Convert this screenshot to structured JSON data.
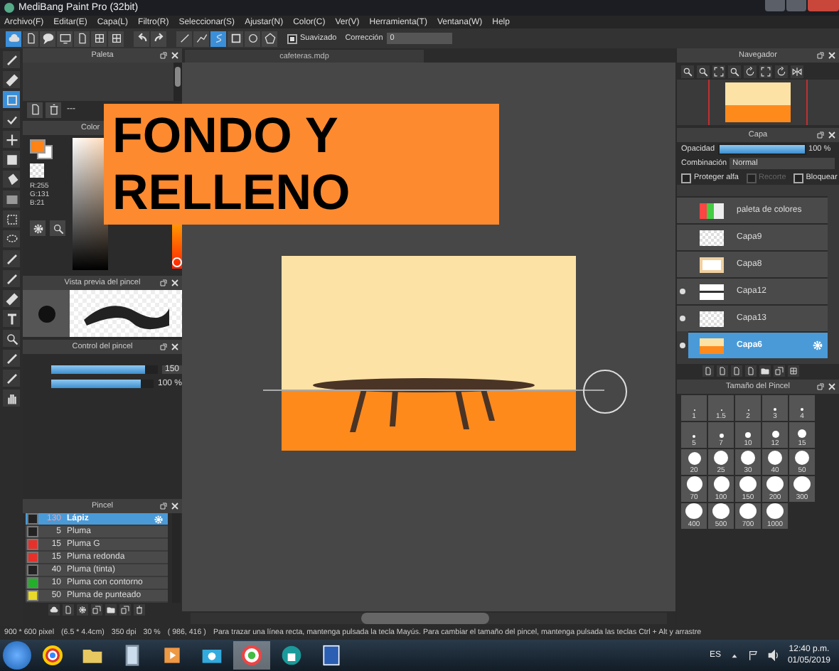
{
  "window": {
    "title": "MediBang Paint Pro (32bit)"
  },
  "menu": [
    "Archivo(F)",
    "Editar(E)",
    "Capa(L)",
    "Filtro(R)",
    "Seleccionar(S)",
    "Ajustar(N)",
    "Color(C)",
    "Ver(V)",
    "Herramienta(T)",
    "Ventana(W)",
    "Help"
  ],
  "toolbar": {
    "file_tools": [
      {
        "kind": "cloud",
        "selected": true
      },
      {
        "kind": "page",
        "selected": false
      },
      {
        "kind": "bubble",
        "selected": false
      },
      {
        "kind": "screen",
        "selected": false
      },
      {
        "kind": "page",
        "selected": false
      },
      {
        "kind": "grid",
        "selected": false
      },
      {
        "kind": "grid",
        "selected": false
      }
    ],
    "history": [
      {
        "kind": "undo"
      },
      {
        "kind": "redo"
      }
    ],
    "shape_tools": [
      {
        "kind": "line",
        "selected": false
      },
      {
        "kind": "polyline",
        "selected": false
      },
      {
        "kind": "curve",
        "selected": true
      },
      {
        "kind": "rect",
        "selected": false
      },
      {
        "kind": "circle",
        "selected": false
      },
      {
        "kind": "polygon",
        "selected": false
      }
    ],
    "smoothing": {
      "label": "Suavizado",
      "checked": true
    },
    "correction": {
      "label": "Corrección",
      "value": "0"
    }
  },
  "tools": [
    {
      "kind": "pen",
      "selected": false
    },
    {
      "kind": "eraser",
      "selected": false
    },
    {
      "kind": "rect",
      "selected": true
    },
    {
      "kind": "check",
      "selected": false
    },
    {
      "kind": "move",
      "selected": false
    },
    {
      "kind": "square",
      "selected": false
    },
    {
      "kind": "bucket",
      "selected": false
    },
    {
      "kind": "gradient",
      "selected": false
    },
    {
      "kind": "marquee",
      "selected": false
    },
    {
      "kind": "lasso",
      "selected": false
    },
    {
      "kind": "pen",
      "selected": false
    },
    {
      "kind": "pen",
      "selected": false
    },
    {
      "kind": "eraser",
      "selected": false
    },
    {
      "kind": "text",
      "selected": false
    },
    {
      "kind": "lens",
      "selected": false
    },
    {
      "kind": "pen",
      "selected": false
    },
    {
      "kind": "pen",
      "selected": false
    },
    {
      "kind": "hand",
      "selected": false
    }
  ],
  "palette": {
    "title": "Paleta",
    "selector": "---"
  },
  "color": {
    "title": "Color",
    "r": "R:255",
    "g": "G:131",
    "b": "B:21",
    "hue": {
      "level": 0.04
    }
  },
  "brush_preview": {
    "title": "Vista previa del pincel"
  },
  "brush_control": {
    "title": "Control del pincel",
    "sliders": [
      {
        "kind": "boxed",
        "level": 0.88,
        "reading": "150"
      },
      {
        "kind": "plain",
        "level": 0.88,
        "reading": "100 %"
      }
    ]
  },
  "brushes": {
    "title": "Pincel",
    "items": [
      {
        "size": "130",
        "name": "Lápiz",
        "color": "#222222",
        "selected": true
      },
      {
        "size": "5",
        "name": "Pluma",
        "color": "#222222",
        "selected": false
      },
      {
        "size": "15",
        "name": "Pluma G",
        "color": "#e8302a",
        "selected": false
      },
      {
        "size": "15",
        "name": "Pluma redonda",
        "color": "#e8302a",
        "selected": false
      },
      {
        "size": "40",
        "name": "Pluma (tinta)",
        "color": "#222222",
        "selected": false
      },
      {
        "size": "10",
        "name": "Pluma con contorno",
        "color": "#22b02a",
        "selected": false
      },
      {
        "size": "50",
        "name": "Pluma de punteado",
        "color": "#e8d82a",
        "selected": false
      }
    ]
  },
  "document": {
    "tab": "cafeteras.mdp"
  },
  "banner": "FONDO Y RELLENO",
  "navigator": {
    "title": "Navegador"
  },
  "layers": {
    "title": "Capa",
    "opacity_label": "Opacidad",
    "opacity": {
      "level": 1,
      "reading": "100 %"
    },
    "blend_label": "Combinación",
    "blend": "Normal",
    "options": [
      {
        "label": "Proteger alfa",
        "checked": false,
        "disabled": false
      },
      {
        "label": "Recorte",
        "checked": false,
        "disabled": true
      },
      {
        "label": "Bloquear",
        "checked": false,
        "disabled": false
      }
    ],
    "items": [
      {
        "name": "paleta de colores",
        "kind": "palette",
        "visible": false,
        "selected": false
      },
      {
        "name": "Capa9",
        "kind": "blank",
        "visible": false,
        "selected": false
      },
      {
        "name": "Capa8",
        "kind": "frame",
        "visible": false,
        "selected": false
      },
      {
        "name": "Capa12",
        "kind": "table",
        "visible": true,
        "selected": false
      },
      {
        "name": "Capa13",
        "kind": "blank",
        "visible": true,
        "selected": false
      },
      {
        "name": "Capa6",
        "kind": "orange",
        "visible": true,
        "selected": true
      }
    ]
  },
  "brush_sizes": {
    "title": "Tamaño del Pincel",
    "sizes": [
      "1",
      "1.5",
      "2",
      "3",
      "4",
      "5",
      "7",
      "10",
      "12",
      "15",
      "20",
      "25",
      "30",
      "40",
      "50",
      "70",
      "100",
      "150",
      "200",
      "300",
      "400",
      "500",
      "700",
      "1000"
    ]
  },
  "status_bar": [
    "900 * 600 pixel",
    "(6.5 * 4.4cm)",
    "350 dpi",
    "30 %",
    "( 986, 416 )",
    "Para trazar una línea recta, mantenga pulsada la tecla Mayús. Para cambiar el tamaño del pincel, mantenga pulsada las teclas Ctrl + Alt y arrastre"
  ],
  "taskbar": {
    "apps": [
      {
        "kind": "chrome",
        "selected": false
      },
      {
        "kind": "folder",
        "selected": false
      },
      {
        "kind": "notepad",
        "selected": false
      },
      {
        "kind": "media",
        "selected": false
      },
      {
        "kind": "camera",
        "selected": false
      },
      {
        "kind": "medibang",
        "selected": true
      },
      {
        "kind": "lock",
        "selected": false
      },
      {
        "kind": "word",
        "selected": false
      }
    ],
    "language": "ES",
    "time": "12:40 p.m.",
    "date": "01/05/2019"
  }
}
